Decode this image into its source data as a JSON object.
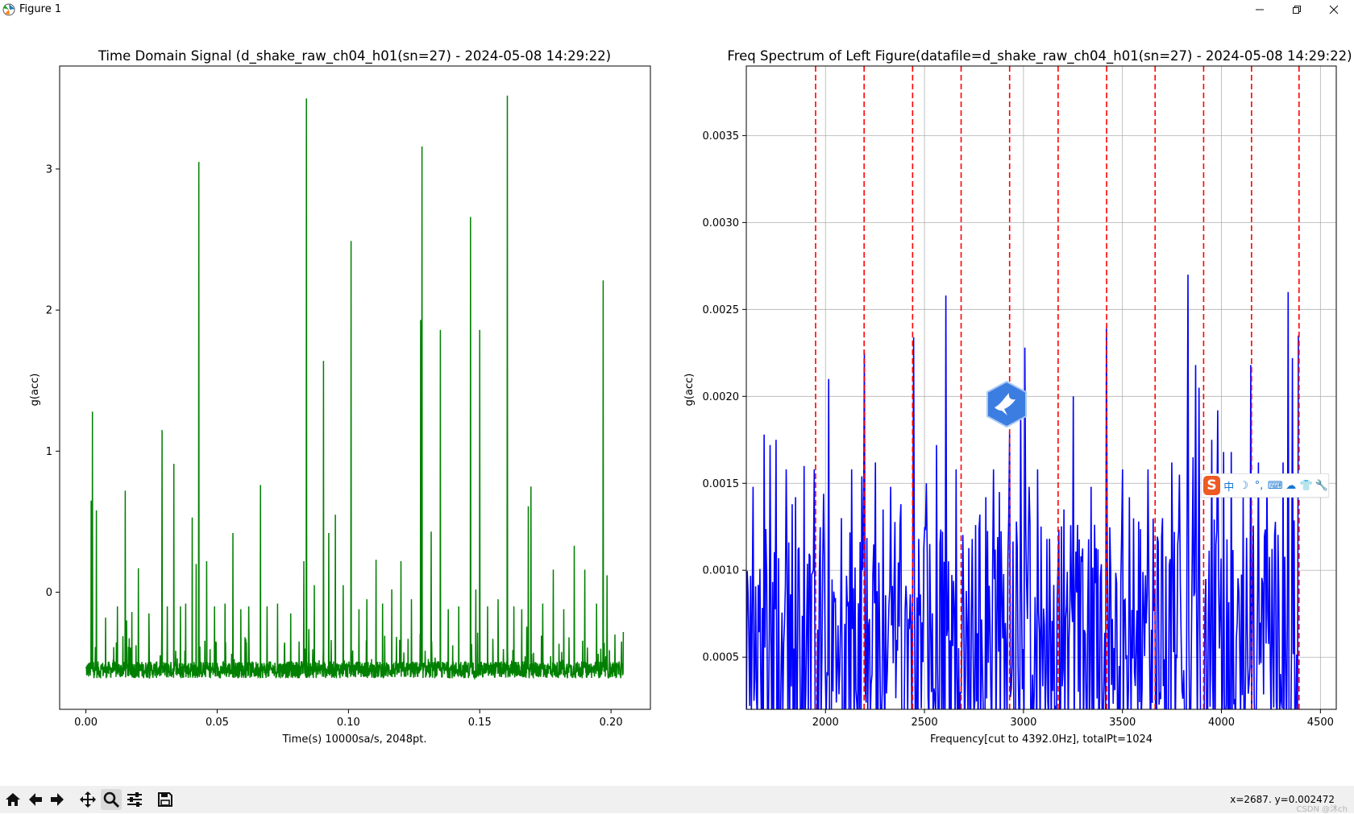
{
  "window": {
    "title": "Figure 1",
    "controls": {
      "minimize": "—",
      "maximize": "❐",
      "close": "✕"
    }
  },
  "toolbar": {
    "buttons": [
      "home",
      "back",
      "forward",
      "pan",
      "zoom",
      "configure-subplots",
      "save"
    ],
    "active": "zoom",
    "coord_readout": "x=2687.  y=0.002472",
    "watermark": "CSDN @沐ch"
  },
  "ime": {
    "logo": "S",
    "items": [
      "中",
      "☽",
      "°,",
      "⌨",
      "☁",
      "👕",
      "🔧"
    ]
  },
  "colors": {
    "time_signal": "#008000",
    "spectrum": "#0000ff",
    "markers": "#ff0000",
    "grid": "#b0b0b0",
    "toolbar_bg": "#f0f0f0"
  },
  "chart_data": [
    {
      "type": "line",
      "title": "Time Domain Signal (d_shake_raw_ch04_h01(sn=27) - 2024-05-08 14:29:22)",
      "xlabel": "Time(s) 10000sa/s, 2048pt.",
      "ylabel": "g(acc)",
      "xlim": [
        -0.01,
        0.215
      ],
      "ylim": [
        -0.83,
        3.73
      ],
      "xticks": [
        0.0,
        0.05,
        0.1,
        0.15,
        0.2
      ],
      "xtick_labels": [
        "0.00",
        "0.05",
        "0.10",
        "0.15",
        "0.20"
      ],
      "yticks": [
        0,
        1,
        2,
        3
      ],
      "ytick_labels": [
        "0",
        "1",
        "2",
        "3"
      ],
      "grid": false,
      "n_points": 2048,
      "x_range": [
        0.0,
        0.2047
      ],
      "baseline": -0.55,
      "noise": 0.06,
      "peaks": [
        [
          0.002,
          0.65
        ],
        [
          0.0025,
          1.28
        ],
        [
          0.004,
          0.58
        ],
        [
          0.0075,
          -0.18
        ],
        [
          0.012,
          -0.1
        ],
        [
          0.015,
          0.72
        ],
        [
          0.0155,
          -0.2
        ],
        [
          0.0175,
          -0.14
        ],
        [
          0.02,
          0.17
        ],
        [
          0.024,
          -0.15
        ],
        [
          0.029,
          1.15
        ],
        [
          0.031,
          -0.1
        ],
        [
          0.0335,
          0.91
        ],
        [
          0.036,
          -0.1
        ],
        [
          0.038,
          -0.08
        ],
        [
          0.0405,
          0.53
        ],
        [
          0.042,
          0.2
        ],
        [
          0.043,
          3.05
        ],
        [
          0.046,
          0.22
        ],
        [
          0.049,
          -0.1
        ],
        [
          0.053,
          -0.08
        ],
        [
          0.056,
          0.42
        ],
        [
          0.059,
          -0.12
        ],
        [
          0.062,
          -0.1
        ],
        [
          0.0665,
          0.76
        ],
        [
          0.069,
          -0.1
        ],
        [
          0.073,
          -0.08
        ],
        [
          0.078,
          -0.15
        ],
        [
          0.083,
          0.22
        ],
        [
          0.084,
          3.5
        ],
        [
          0.087,
          0.05
        ],
        [
          0.0905,
          1.64
        ],
        [
          0.0925,
          0.42
        ],
        [
          0.095,
          0.55
        ],
        [
          0.098,
          0.05
        ],
        [
          0.101,
          2.49
        ],
        [
          0.104,
          -0.12
        ],
        [
          0.107,
          -0.05
        ],
        [
          0.1105,
          0.23
        ],
        [
          0.113,
          -0.08
        ],
        [
          0.1165,
          0.02
        ],
        [
          0.12,
          0.22
        ],
        [
          0.124,
          -0.05
        ],
        [
          0.1275,
          1.93
        ],
        [
          0.128,
          3.16
        ],
        [
          0.1315,
          0.43
        ],
        [
          0.135,
          1.86
        ],
        [
          0.138,
          -0.12
        ],
        [
          0.142,
          -0.1
        ],
        [
          0.1465,
          2.66
        ],
        [
          0.1485,
          0.02
        ],
        [
          0.15,
          1.86
        ],
        [
          0.153,
          -0.1
        ],
        [
          0.157,
          -0.05
        ],
        [
          0.1605,
          3.52
        ],
        [
          0.163,
          -0.1
        ],
        [
          0.166,
          -0.12
        ],
        [
          0.1685,
          0.61
        ],
        [
          0.1695,
          0.75
        ],
        [
          0.174,
          -0.08
        ],
        [
          0.178,
          0.16
        ],
        [
          0.182,
          -0.12
        ],
        [
          0.186,
          0.33
        ],
        [
          0.19,
          0.16
        ],
        [
          0.1945,
          -0.08
        ],
        [
          0.197,
          2.21
        ],
        [
          0.1985,
          0.12
        ],
        [
          0.2015,
          -0.3
        ],
        [
          0.204,
          -0.35
        ]
      ]
    },
    {
      "type": "line",
      "title": "Freq Spectrum of Left Figure(datafile=d_shake_raw_ch04_h01(sn=27) - 2024-05-08 14:29:22)",
      "xlabel": "Frequency[cut to 4392.0Hz], totalPt=1024",
      "ylabel": "g(acc)",
      "xlim": [
        1600,
        4580
      ],
      "ylim": [
        0.0002,
        0.0039
      ],
      "xticks": [
        2000,
        2500,
        3000,
        3500,
        4000,
        4500
      ],
      "xtick_labels": [
        "2000",
        "2500",
        "3000",
        "3500",
        "4000",
        "4500"
      ],
      "yticks": [
        0.0005,
        0.001,
        0.0015,
        0.002,
        0.0025,
        0.003,
        0.0035
      ],
      "ytick_labels": [
        "0.0005",
        "0.0010",
        "0.0015",
        "0.0020",
        "0.0025",
        "0.0030",
        "0.0035"
      ],
      "grid": true,
      "markers_x": [
        1950,
        2195,
        2440,
        2685,
        2930,
        3175,
        3420,
        3665,
        3910,
        4152,
        4392
      ],
      "spectrum_x_range": [
        1600,
        4392
      ],
      "peaks": [
        [
          1610,
          0.00088
        ],
        [
          1635,
          0.00148
        ],
        [
          1690,
          0.00178
        ],
        [
          1720,
          0.00172
        ],
        [
          1750,
          0.00175
        ],
        [
          1800,
          0.00158
        ],
        [
          1830,
          0.00138
        ],
        [
          1850,
          0.00142
        ],
        [
          1890,
          0.0016
        ],
        [
          1920,
          0.00108
        ],
        [
          1945,
          0.00158
        ],
        [
          1970,
          0.00098
        ],
        [
          1990,
          0.00144
        ],
        [
          2015,
          0.0021
        ],
        [
          2050,
          0.00084
        ],
        [
          2080,
          0.0013
        ],
        [
          2130,
          0.00158
        ],
        [
          2185,
          0.00154
        ],
        [
          2195,
          0.00225
        ],
        [
          2220,
          0.00072
        ],
        [
          2250,
          0.00162
        ],
        [
          2290,
          0.00135
        ],
        [
          2330,
          0.00148
        ],
        [
          2380,
          0.00138
        ],
        [
          2420,
          0.00072
        ],
        [
          2445,
          0.00234
        ],
        [
          2470,
          0.00118
        ],
        [
          2510,
          0.0015
        ],
        [
          2560,
          0.00172
        ],
        [
          2610,
          0.00258
        ],
        [
          2660,
          0.00158
        ],
        [
          2700,
          0.00078
        ],
        [
          2740,
          0.00118
        ],
        [
          2780,
          0.00132
        ],
        [
          2810,
          0.00142
        ],
        [
          2850,
          0.00158
        ],
        [
          2880,
          0.00145
        ],
        [
          2930,
          0.0018
        ],
        [
          2965,
          0.00128
        ],
        [
          2985,
          0.00198
        ],
        [
          3005,
          0.00228
        ],
        [
          3030,
          0.00148
        ],
        [
          3070,
          0.00158
        ],
        [
          3120,
          0.00118
        ],
        [
          3175,
          0.00102
        ],
        [
          3205,
          0.00135
        ],
        [
          3250,
          0.002
        ],
        [
          3290,
          0.00108
        ],
        [
          3340,
          0.00148
        ],
        [
          3375,
          0.00112
        ],
        [
          3420,
          0.00239
        ],
        [
          3450,
          0.00072
        ],
        [
          3500,
          0.00158
        ],
        [
          3535,
          0.00142
        ],
        [
          3580,
          0.00128
        ],
        [
          3630,
          0.00158
        ],
        [
          3665,
          0.00088
        ],
        [
          3700,
          0.0013
        ],
        [
          3720,
          0.00108
        ],
        [
          3750,
          0.00162
        ],
        [
          3790,
          0.00155
        ],
        [
          3830,
          0.0027
        ],
        [
          3855,
          0.00165
        ],
        [
          3870,
          0.00218
        ],
        [
          3885,
          0.00205
        ],
        [
          3920,
          0.00095
        ],
        [
          3950,
          0.00175
        ],
        [
          3980,
          0.00192
        ],
        [
          4010,
          0.00168
        ],
        [
          4050,
          0.00168
        ],
        [
          4110,
          0.00142
        ],
        [
          4150,
          0.00218
        ],
        [
          4185,
          0.00162
        ],
        [
          4230,
          0.00155
        ],
        [
          4270,
          0.0012
        ],
        [
          4310,
          0.00162
        ],
        [
          4335,
          0.0026
        ],
        [
          4360,
          0.00222
        ],
        [
          4390,
          0.00235
        ]
      ]
    }
  ]
}
